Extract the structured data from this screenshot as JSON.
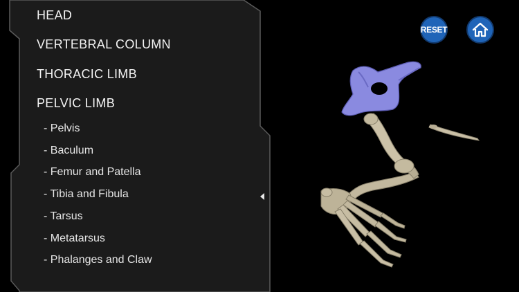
{
  "menu": {
    "categories": [
      {
        "label": "HEAD"
      },
      {
        "label": "VERTEBRAL COLUMN"
      },
      {
        "label": "THORACIC LIMB"
      },
      {
        "label": "PELVIC LIMB"
      }
    ],
    "pelvic_limb_items": [
      {
        "label": "- Pelvis"
      },
      {
        "label": "- Baculum"
      },
      {
        "label": "- Femur and Patella"
      },
      {
        "label": "- Tibia and Fibula"
      },
      {
        "label": "- Tarsus"
      },
      {
        "label": "- Metatarsus"
      },
      {
        "label": "- Phalanges and Claw"
      }
    ],
    "collapse_icon": "chevron-left-icon"
  },
  "toolbar": {
    "reset_label": "RESET",
    "home_icon": "home-icon"
  },
  "model": {
    "highlighted_bone": "Pelvis",
    "highlight_color": "#8a8ae0",
    "bone_color": "#c9bfa6"
  }
}
